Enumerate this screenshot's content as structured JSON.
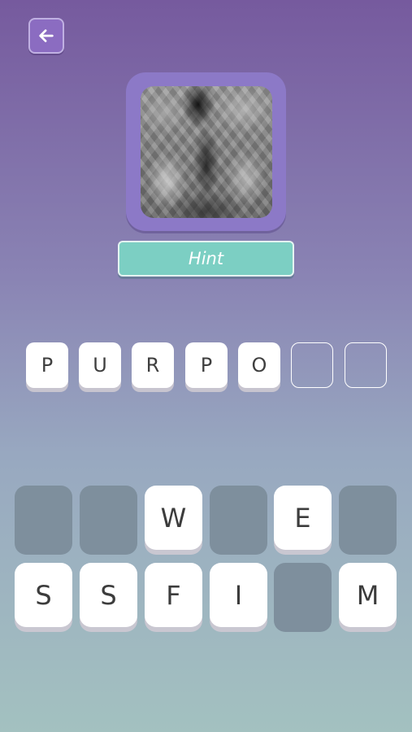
{
  "colors": {
    "background_top": "#765a9e",
    "background_bottom": "#a3c1c0",
    "frame": "#8c79c7",
    "hint_button": "#7ccfc3",
    "back_button": "#8b6cc1",
    "used_key": "#7e8f9d"
  },
  "back_button": {
    "icon": "arrow-left-icon"
  },
  "hint_button": {
    "label": "Hint"
  },
  "answer_slots": [
    "P",
    "U",
    "R",
    "P",
    "O",
    "",
    ""
  ],
  "keyboard": {
    "row1": [
      {
        "letter": "",
        "used": true
      },
      {
        "letter": "",
        "used": true
      },
      {
        "letter": "W",
        "used": false
      },
      {
        "letter": "",
        "used": true
      },
      {
        "letter": "E",
        "used": false
      },
      {
        "letter": "",
        "used": true
      }
    ],
    "row2": [
      {
        "letter": "S",
        "used": false
      },
      {
        "letter": "S",
        "used": false
      },
      {
        "letter": "F",
        "used": false
      },
      {
        "letter": "I",
        "used": false
      },
      {
        "letter": "",
        "used": true
      },
      {
        "letter": "M",
        "used": false
      }
    ]
  }
}
